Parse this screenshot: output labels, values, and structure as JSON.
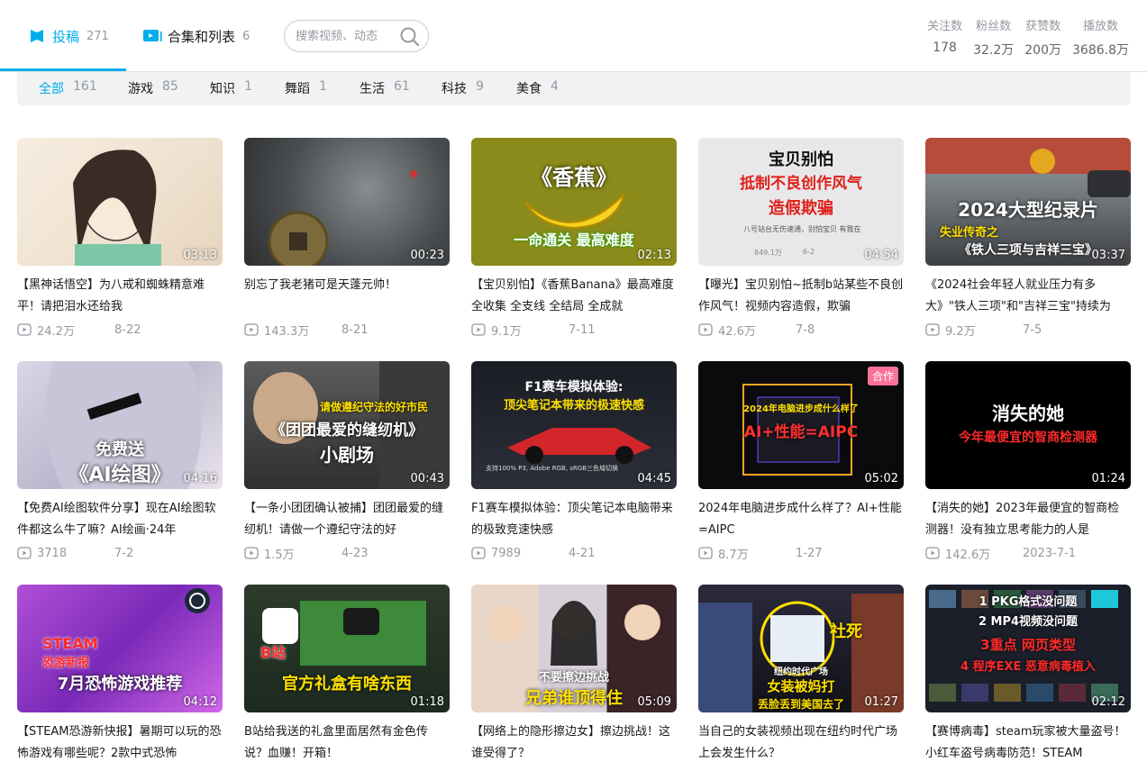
{
  "tabs": [
    {
      "label": "投稿",
      "count": "271"
    },
    {
      "label": "合集和列表",
      "count": "6"
    }
  ],
  "search": {
    "placeholder": "搜索视频、动态"
  },
  "stats": [
    {
      "label": "关注数",
      "value": "178"
    },
    {
      "label": "粉丝数",
      "value": "32.2万"
    },
    {
      "label": "获赞数",
      "value": "200万"
    },
    {
      "label": "播放数",
      "value": "3686.8万"
    }
  ],
  "filters": [
    {
      "label": "全部",
      "count": "161"
    },
    {
      "label": "游戏",
      "count": "85"
    },
    {
      "label": "知识",
      "count": "1"
    },
    {
      "label": "舞蹈",
      "count": "1"
    },
    {
      "label": "生活",
      "count": "61"
    },
    {
      "label": "科技",
      "count": "9"
    },
    {
      "label": "美食",
      "count": "4"
    }
  ],
  "colors": {
    "accent": "#00aeec",
    "coop_badge": "#fb7299"
  },
  "videos": [
    {
      "title": "【黑神话悟空】为八戒和蜘蛛精意难平！请把泪水还给我",
      "duration": "03:13",
      "views": "24.2万",
      "date": "8-22",
      "thumb_text": [],
      "badge": ""
    },
    {
      "title": "别忘了我老猪可是天蓬元帅！",
      "duration": "00:23",
      "views": "143.3万",
      "date": "8-21",
      "thumb_text": [],
      "badge": ""
    },
    {
      "title": "【宝贝别怕】《香蕉Banana》最高难度 全收集 全支线 全结局 全成就",
      "duration": "02:13",
      "views": "9.1万",
      "date": "7-11",
      "thumb_text": [
        "《香蕉》",
        "一命通关 最高难度"
      ],
      "badge": ""
    },
    {
      "title": "【曝光】宝贝别怕~抵制b站某些不良创作风气！视频内容造假，欺骗",
      "duration": "04:54",
      "views": "42.6万",
      "date": "7-8",
      "thumb_text": [
        "宝贝别怕",
        "抵制不良创作风气",
        "造假欺骗",
        "八号站台无伤速通，别怕宝贝 有我在",
        "849.1万",
        "6-2"
      ],
      "badge": ""
    },
    {
      "title": "《2024社会年轻人就业压力有多大》\"铁人三项\"和\"吉祥三宝\"持续为",
      "duration": "03:37",
      "views": "9.2万",
      "date": "7-5",
      "thumb_text": [
        "2024大型纪录片",
        "失业传奇之",
        "《铁人三项与吉祥三宝》"
      ],
      "badge": ""
    },
    {
      "title": "【免费AI绘图软件分享】现在AI绘图软件都这么牛了嘛？AI绘画·24年",
      "duration": "04:16",
      "views": "3718",
      "date": "7-2",
      "thumb_text": [
        "免费送",
        "《AI绘图》"
      ],
      "badge": ""
    },
    {
      "title": "【一条小团团确认被捕】团团最爱的缝纫机！请做一个遵纪守法的好",
      "duration": "00:43",
      "views": "1.5万",
      "date": "4-23",
      "thumb_text": [
        "请做遵纪守法的好市民",
        "《团团最爱的缝纫机》",
        "小剧场"
      ],
      "badge": ""
    },
    {
      "title": "F1赛车模拟体验：顶尖笔记本电脑带来的极致竞速快感",
      "duration": "04:45",
      "views": "7989",
      "date": "4-21",
      "thumb_text": [
        "F1赛车模拟体验:",
        "顶尖笔记本带来的极速快感",
        "支持100% P3, Adobe RGB, sRGB三色域切换"
      ],
      "badge": ""
    },
    {
      "title": "2024年电脑进步成什么样了？AI+性能=AIPC",
      "duration": "05:02",
      "views": "8.7万",
      "date": "1-27",
      "thumb_text": [
        "2024年电脑进步成什么样了",
        "AI+性能=AIPC"
      ],
      "badge": "合作"
    },
    {
      "title": "【消失的她】2023年最便宜的智商检测器！没有独立思考能力的人是",
      "duration": "01:24",
      "views": "142.6万",
      "date": "2023-7-1",
      "thumb_text": [
        "消失的她",
        "今年最便宜的智商检测器"
      ],
      "badge": ""
    },
    {
      "title": "【STEAM恐游新快报】暑期可以玩的恐怖游戏有哪些呢？2款中式恐怖",
      "duration": "04:12",
      "views": "",
      "date": "",
      "thumb_text": [
        "STEAM",
        "恐游新报",
        "7月恐怖游戏推荐"
      ],
      "badge": ""
    },
    {
      "title": "B站给我送的礼盒里面居然有金色传说？血赚！开箱！",
      "duration": "01:18",
      "views": "",
      "date": "",
      "thumb_text": [
        "B站",
        "官方礼盒有啥东西"
      ],
      "badge": ""
    },
    {
      "title": "【网络上的隐形擦边女】擦边挑战！这谁受得了？",
      "duration": "05:09",
      "views": "",
      "date": "",
      "thumb_text": [
        "不要擦边挑战",
        "兄弟谁顶得住"
      ],
      "badge": ""
    },
    {
      "title": "当自己的女装视频出现在纽约时代广场上会发生什么？",
      "duration": "01:27",
      "views": "",
      "date": "",
      "thumb_text": [
        "社死",
        "纽约时代广场",
        "女装被妈打",
        "丢脸丢到美国去了"
      ],
      "badge": ""
    },
    {
      "title": "【赛博病毒】steam玩家被大量盗号！小红车盗号病毒防范！STEAM",
      "duration": "02:12",
      "views": "",
      "date": "",
      "thumb_text": [
        "1 PKG格式没问题",
        "2 MP4视频没问题",
        "3重点 网页类型",
        "4 程序EXE 恶意病毒植入"
      ],
      "badge": ""
    }
  ]
}
